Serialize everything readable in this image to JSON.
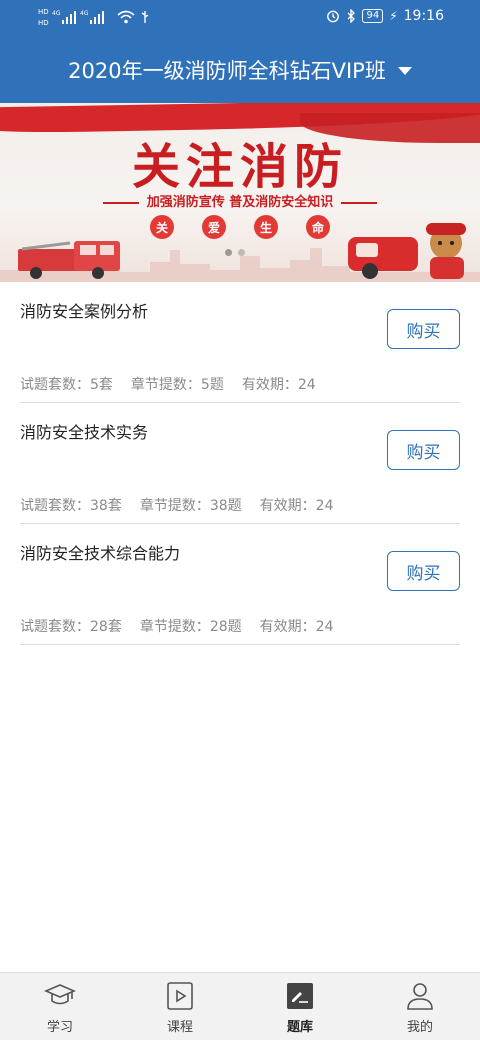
{
  "status_bar": {
    "network_left": "HD 4G",
    "time": "19:16",
    "battery": "94"
  },
  "header": {
    "title": "2020年一级消防师全科钻石VIP班",
    "dropdown_icon": "caret-down-icon",
    "bg_color": "#2f72b9"
  },
  "banner": {
    "title": "关注消防",
    "subtitle": "加强消防宣传  普及消防安全知识",
    "chips": [
      "关",
      "爱",
      "生",
      "命"
    ],
    "page_count": 2,
    "active_page": 1
  },
  "courses": [
    {
      "name": "消防安全案例分析",
      "buy_label": "购买",
      "sets": "试题套数：5套",
      "chapters": "章节提数：5题",
      "validity": "有效期：24"
    },
    {
      "name": "消防安全技术实务",
      "buy_label": "购买",
      "sets": "试题套数：38套",
      "chapters": "章节提数：38题",
      "validity": "有效期：24"
    },
    {
      "name": "消防安全技术综合能力",
      "buy_label": "购买",
      "sets": "试题套数：28套",
      "chapters": "章节提数：28题",
      "validity": "有效期：24"
    }
  ],
  "tabbar": {
    "items": [
      {
        "label": "学习",
        "icon": "graduation-cap-icon"
      },
      {
        "label": "课程",
        "icon": "play-video-icon"
      },
      {
        "label": "题库",
        "icon": "edit-exam-icon",
        "active": true
      },
      {
        "label": "我的",
        "icon": "user-profile-icon"
      }
    ]
  },
  "colors": {
    "accent": "#2f72b9",
    "banner_red": "#c81d21"
  }
}
